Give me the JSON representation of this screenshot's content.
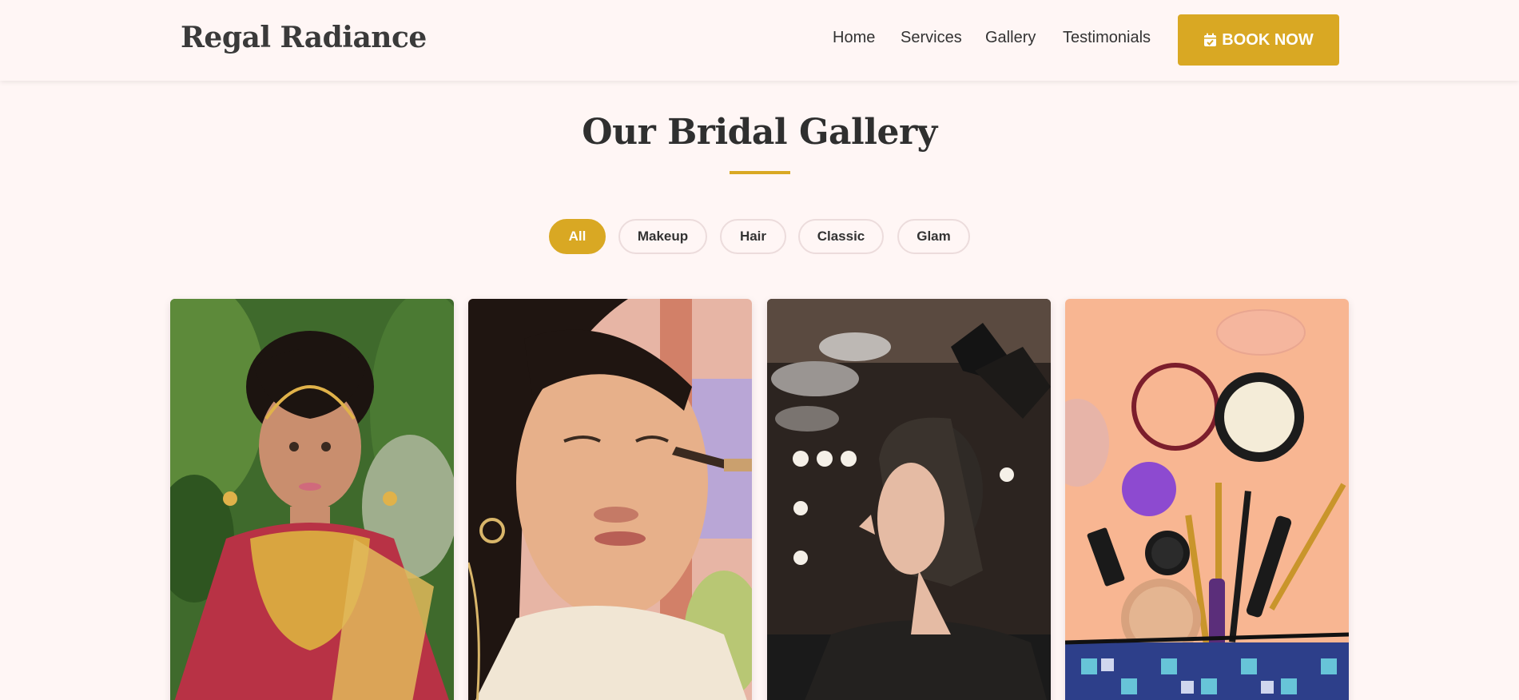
{
  "header": {
    "logo": "Regal Radiance",
    "nav": [
      "Home",
      "Services",
      "Gallery",
      "Testimonials"
    ],
    "book_button": "BOOK NOW"
  },
  "gallery": {
    "title": "Our Bridal Gallery",
    "filters": [
      {
        "label": "All",
        "active": true
      },
      {
        "label": "Makeup",
        "active": false
      },
      {
        "label": "Hair",
        "active": false
      },
      {
        "label": "Classic",
        "active": false
      },
      {
        "label": "Glam",
        "active": false
      }
    ],
    "photos": [
      {
        "subject": "bride-with-gold-jewelry-photo"
      },
      {
        "subject": "makeup-brush-application-photo"
      },
      {
        "subject": "hair-coloring-salon-photo"
      },
      {
        "subject": "makeup-products-flatlay-photo"
      }
    ]
  },
  "colors": {
    "accent": "#d9a823",
    "background": "#fff6f5",
    "text": "#333333"
  }
}
